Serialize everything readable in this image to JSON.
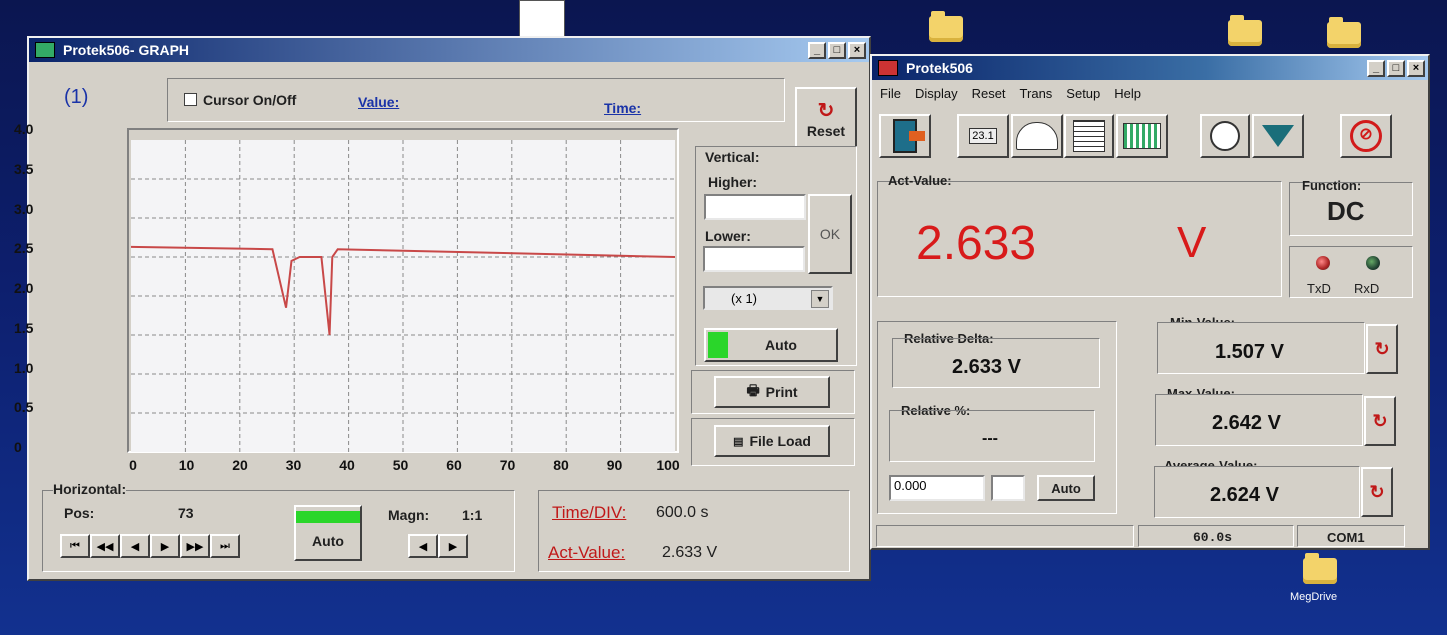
{
  "desktop": {
    "drive_label": "MegDrive"
  },
  "graph_window": {
    "title": "Protek506- GRAPH",
    "channel": "(1)",
    "cursor_label": "Cursor On/Off",
    "value_label": "Value:",
    "time_label": "Time:",
    "reset_label": "Reset",
    "vertical_label": "Vertical:",
    "higher_label": "Higher:",
    "lower_label": "Lower:",
    "ok_label": "OK",
    "scale_select": "(x 1)",
    "auto_label": "Auto",
    "print_label": "Print",
    "file_load_label": "File Load",
    "horizontal_label": "Horizontal:",
    "pos_label": "Pos:",
    "pos_value": "73",
    "h_auto_label": "Auto",
    "magn_label": "Magn:",
    "magn_value": "1:1",
    "time_div_label": "Time/DIV:",
    "time_div_value": "600.0 s",
    "act_value_label": "Act-Value:",
    "act_value": "2.633 V",
    "nav_buttons": [
      "⏮",
      "◀◀",
      "◀",
      "▶",
      "▶▶",
      "⏭"
    ]
  },
  "chart_data": {
    "type": "line",
    "xlim": [
      0,
      100
    ],
    "ylim": [
      0,
      4.0
    ],
    "x_ticks": [
      "0",
      "10",
      "20",
      "30",
      "40",
      "50",
      "60",
      "70",
      "80",
      "90",
      "100"
    ],
    "y_ticks": [
      "4.0",
      "3.5",
      "3.0",
      "2.5",
      "2.0",
      "1.5",
      "1.0",
      "0.5",
      "0"
    ],
    "grid": true,
    "series": [
      {
        "color": "#c84848",
        "x": [
          0,
          26,
          28.5,
          29.5,
          31,
          35,
          36.5,
          37,
          38,
          100
        ],
        "y": [
          2.63,
          2.6,
          1.85,
          2.45,
          2.5,
          2.5,
          1.5,
          2.5,
          2.6,
          2.5
        ]
      }
    ]
  },
  "meter_window": {
    "title": "Protek506",
    "menu": [
      "File",
      "Display",
      "Reset",
      "Trans",
      "Setup",
      "Help"
    ],
    "act_value_label": "Act-Value:",
    "act_value": "2.633",
    "unit": "V",
    "function_label": "Function:",
    "function_value": "DC",
    "txd_label": "TxD",
    "rxd_label": "RxD",
    "relative_delta_label": "Relative Delta:",
    "relative_delta_value": "2.633 V",
    "relative_pct_label": "Relative %:",
    "relative_pct_value": "---",
    "offset_input": "0.000",
    "offset_auto_label": "Auto",
    "min_label": "Min-Value:",
    "min_value": "1.507 V",
    "max_label": "Max-Value:",
    "max_value": "2.642 V",
    "avg_label": "Average-Value:",
    "avg_value": "2.624 V",
    "status_interval": "60.0s",
    "status_port": "COM1",
    "lcd_display": "23.1"
  },
  "colors": {
    "title_bar": "#0a246a",
    "value_red": "#d81a1a",
    "auto_green": "#2ad62a"
  }
}
